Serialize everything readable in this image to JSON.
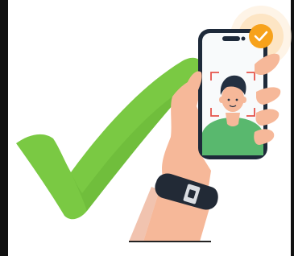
{
  "illustration": {
    "subject": "face-verification",
    "colors": {
      "check_green": "#7AC943",
      "check_green_dark": "#5FAE2E",
      "badge_orange": "#F7A21B",
      "badge_glow": "#FDEBD3",
      "skin": "#F6B899",
      "skin_shadow": "#E89B7A",
      "phone_frame": "#1E2A3A",
      "screen_bg": "#F8FAFB",
      "shirt_green": "#59B86E",
      "hair": "#243041",
      "scan_corners": "#E5534B",
      "watch_band": "#222A36",
      "watch_clasp": "#DADDE2",
      "frame_edge": "#111111"
    },
    "icons": [
      "checkmark-icon",
      "verified-badge-icon",
      "phone-icon",
      "face-scan-frame-icon",
      "hand-icon",
      "watch-icon"
    ]
  }
}
